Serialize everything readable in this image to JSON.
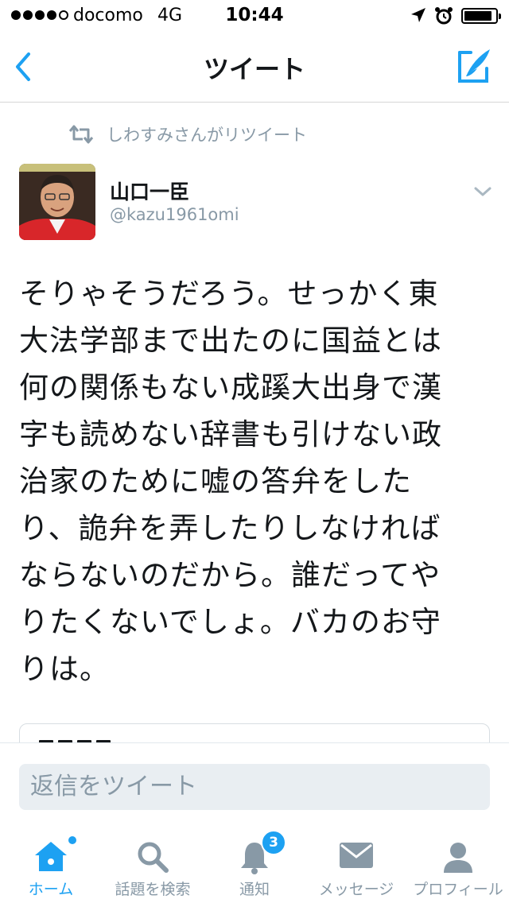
{
  "status_bar": {
    "carrier": "docomo",
    "network": "4G",
    "time": "10:44",
    "signal_bars_filled": 4,
    "signal_bars_total": 5,
    "icons": [
      "signal-dots-icon",
      "location-arrow-icon",
      "alarm-clock-icon",
      "battery-icon"
    ]
  },
  "nav": {
    "title": "ツイート",
    "back_icon": "chevron-left-icon",
    "compose_icon": "compose-feather-icon"
  },
  "tweet": {
    "retweeted_by": "しわすみさんがリツイート",
    "author_name": "山口一臣",
    "author_handle": "@kazu1961omi",
    "text": "そりゃそうだろう。せっかく東\n大法学部まで出たのに国益とは\n何の関係もない成蹊大出身で漢\n字も読めない辞書も引けない政\n治家のために嘘の答弁をした\nり、詭弁を弄したりしなければ\nならないのだから。誰だってや\nりたくないでしょ。バカのお守\nりは。"
  },
  "reply": {
    "placeholder": "返信をツイート"
  },
  "tabs": [
    {
      "label": "ホーム",
      "icon": "home-icon",
      "active": true
    },
    {
      "label": "話題を検索",
      "icon": "search-icon",
      "active": false
    },
    {
      "label": "通知",
      "icon": "bell-icon",
      "active": false,
      "badge": "3"
    },
    {
      "label": "メッセージ",
      "icon": "envelope-icon",
      "active": false
    },
    {
      "label": "プロフィール",
      "icon": "person-icon",
      "active": false
    }
  ],
  "colors": {
    "accent": "#1da1f2",
    "muted": "#8899a6",
    "text": "#14171a"
  }
}
